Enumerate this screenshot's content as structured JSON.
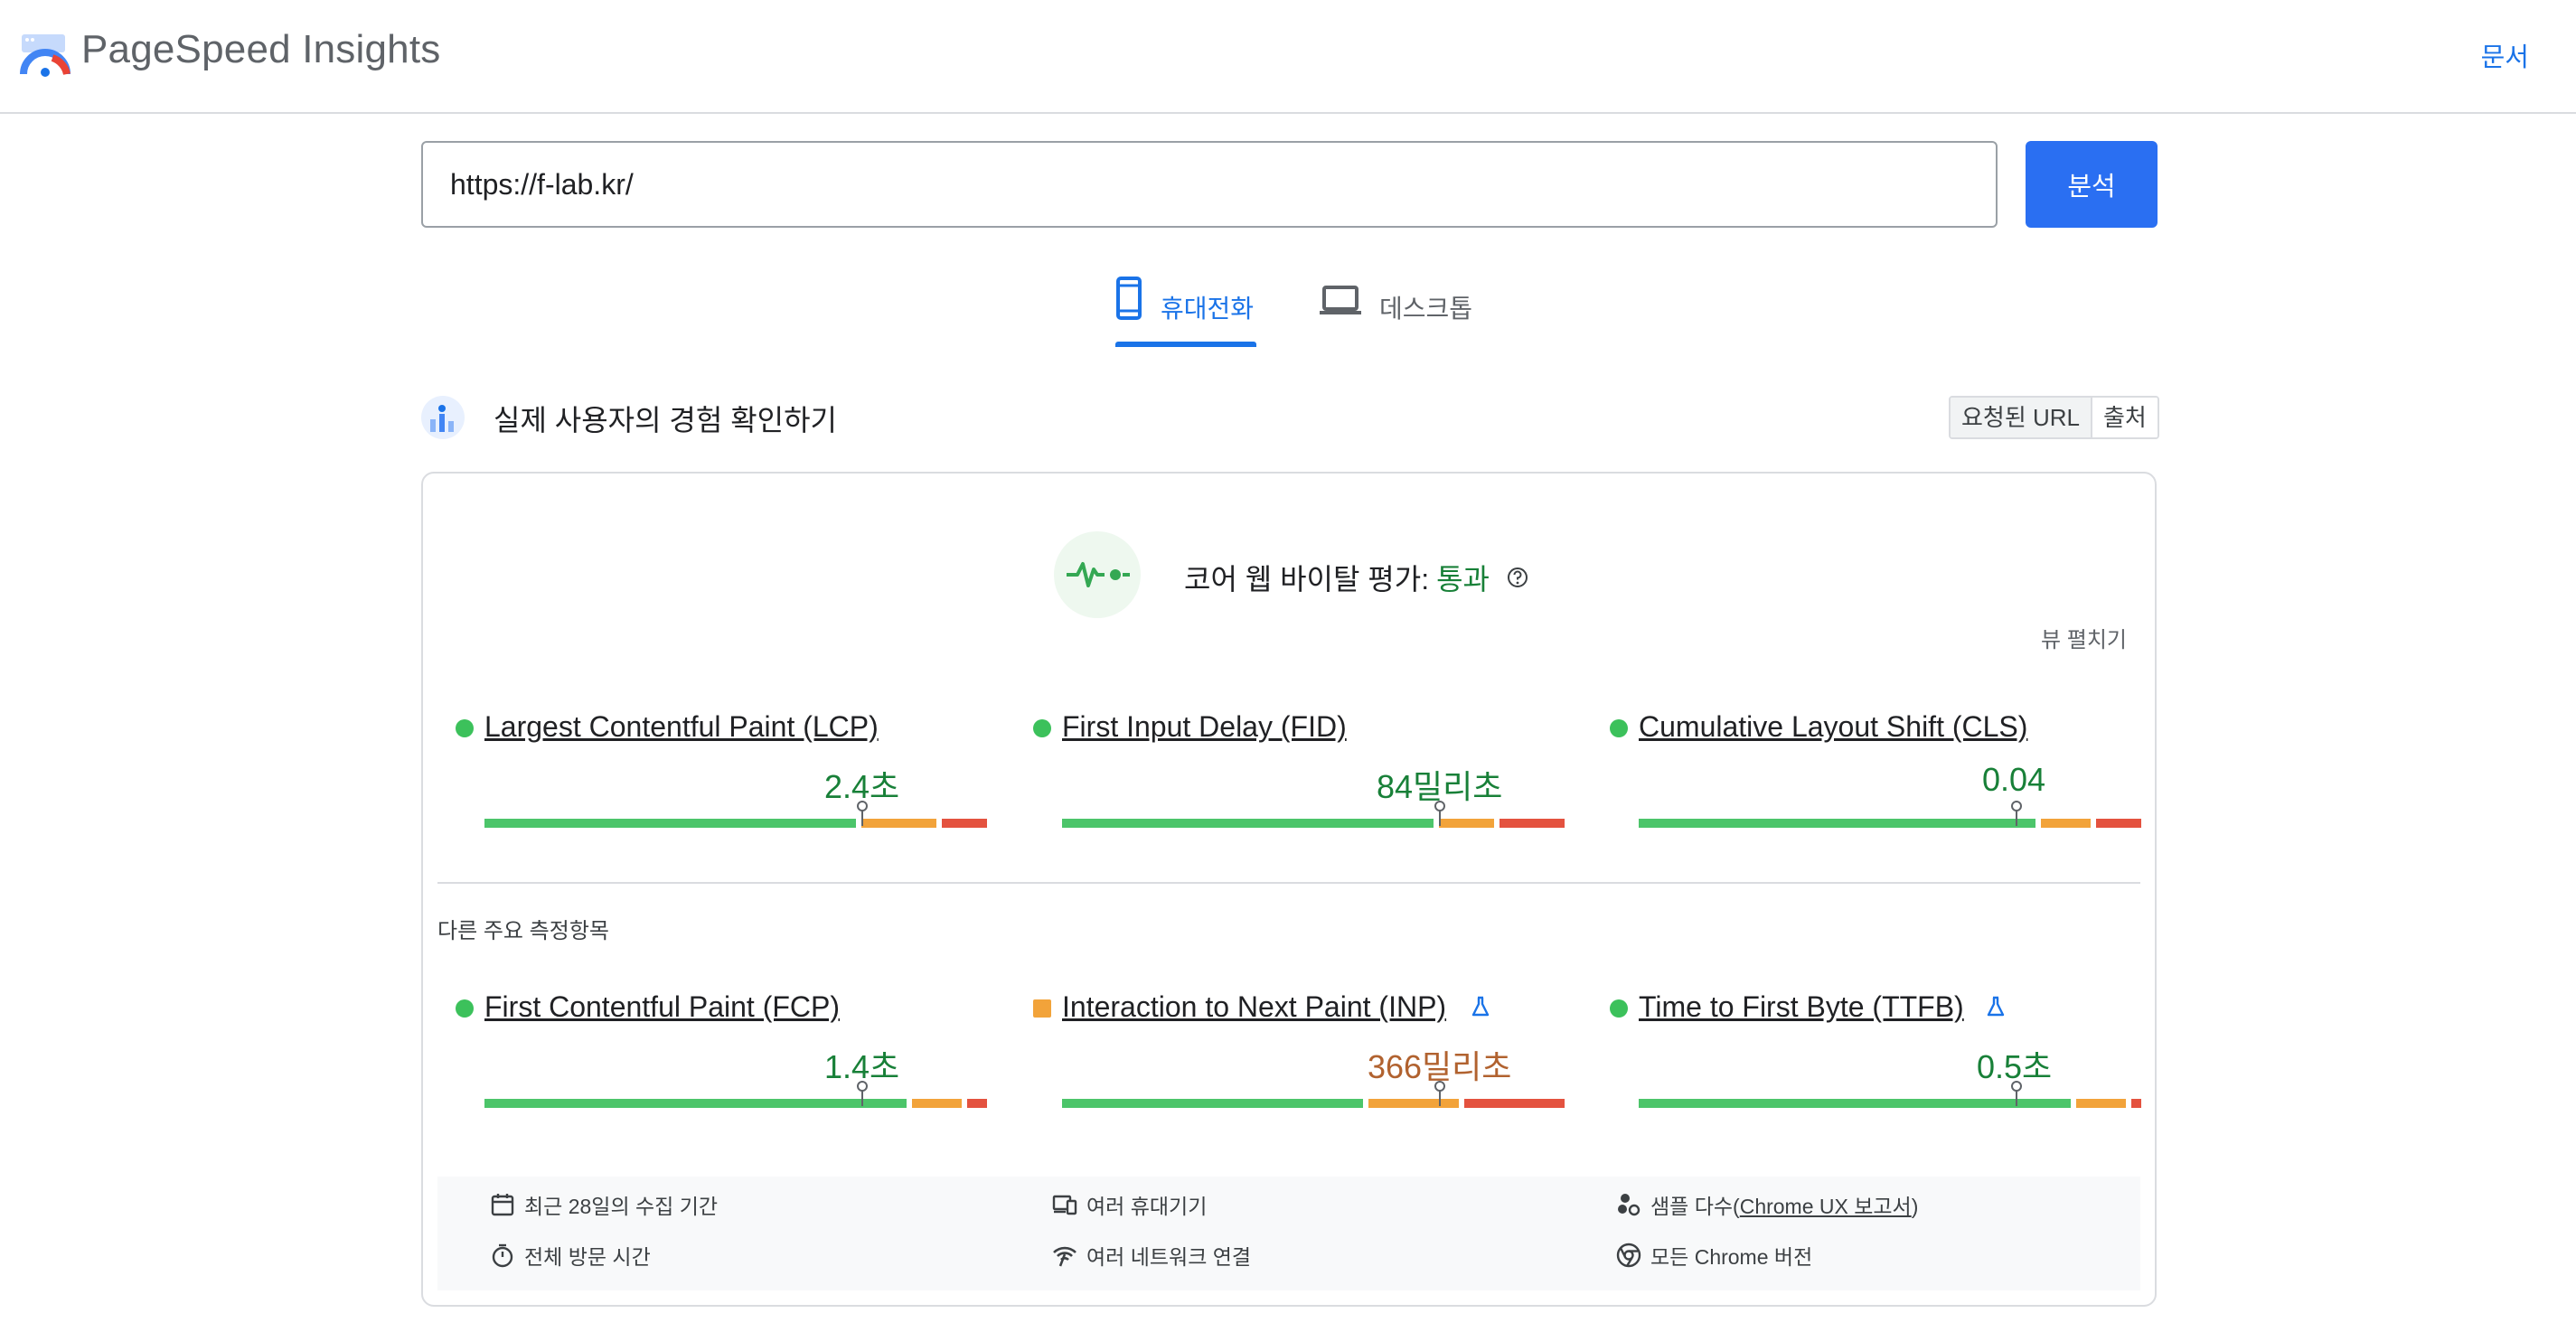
{
  "header": {
    "brand": "PageSpeed Insights",
    "docs_label": "문서"
  },
  "search": {
    "url_value": "https://f-lab.kr/",
    "analyze_label": "분석"
  },
  "tabs": [
    {
      "label": "휴대전화",
      "active": true,
      "icon": "smartphone-icon"
    },
    {
      "label": "데스크톱",
      "active": false,
      "icon": "laptop-icon"
    }
  ],
  "section": {
    "title": "실제 사용자의 경험 확인하기",
    "toggle_url": "요청된 URL",
    "toggle_origin": "출처"
  },
  "assessment": {
    "label": "코어 웹 바이탈 평가: ",
    "status": "통과",
    "expand_label": "뷰 펼치기",
    "status_color": "#188038"
  },
  "core_metrics": [
    {
      "name": "Largest Contentful Paint (LCP)",
      "value": "2.4초",
      "rating": "good",
      "distribution": [
        0.75,
        0.16,
        0.09
      ],
      "marker": 0.75
    },
    {
      "name": "First Input Delay (FID)",
      "value": "84밀리초",
      "rating": "good",
      "distribution": [
        0.75,
        0.12,
        0.13
      ],
      "marker": 0.75
    },
    {
      "name": "Cumulative Layout Shift (CLS)",
      "value": "0.04",
      "rating": "good",
      "distribution": [
        0.8,
        0.11,
        0.09
      ],
      "marker": 0.75
    }
  ],
  "other_label": "다른 주요 측정항목",
  "other_metrics": [
    {
      "name": "First Contentful Paint (FCP)",
      "value": "1.4초",
      "rating": "good",
      "experimental": false,
      "distribution": [
        0.85,
        0.11,
        0.04
      ],
      "marker": 0.75
    },
    {
      "name": "Interaction to Next Paint (INP)",
      "value": "366밀리초",
      "rating": "needs-improvement",
      "experimental": true,
      "distribution": [
        0.61,
        0.19,
        0.2
      ],
      "marker": 0.75
    },
    {
      "name": "Time to First Byte (TTFB)",
      "value": "0.5초",
      "rating": "good",
      "experimental": true,
      "distribution": [
        0.87,
        0.11,
        0.02
      ],
      "marker": 0.75
    }
  ],
  "info": {
    "period": "최근 28일의 수집 기간",
    "devices": "여러 휴대기기",
    "samples_prefix": "샘플 다수(",
    "samples_link": "Chrome UX 보고서",
    "samples_suffix": ")",
    "duration": "전체 방문 시간",
    "network": "여러 네트워크 연결",
    "chrome": "모든 Chrome 버전"
  },
  "colors": {
    "accent": "#1a73e8",
    "button": "#2a6ff2",
    "good": "#4cc56a",
    "average": "#f2a33a",
    "poor": "#e4523f"
  }
}
